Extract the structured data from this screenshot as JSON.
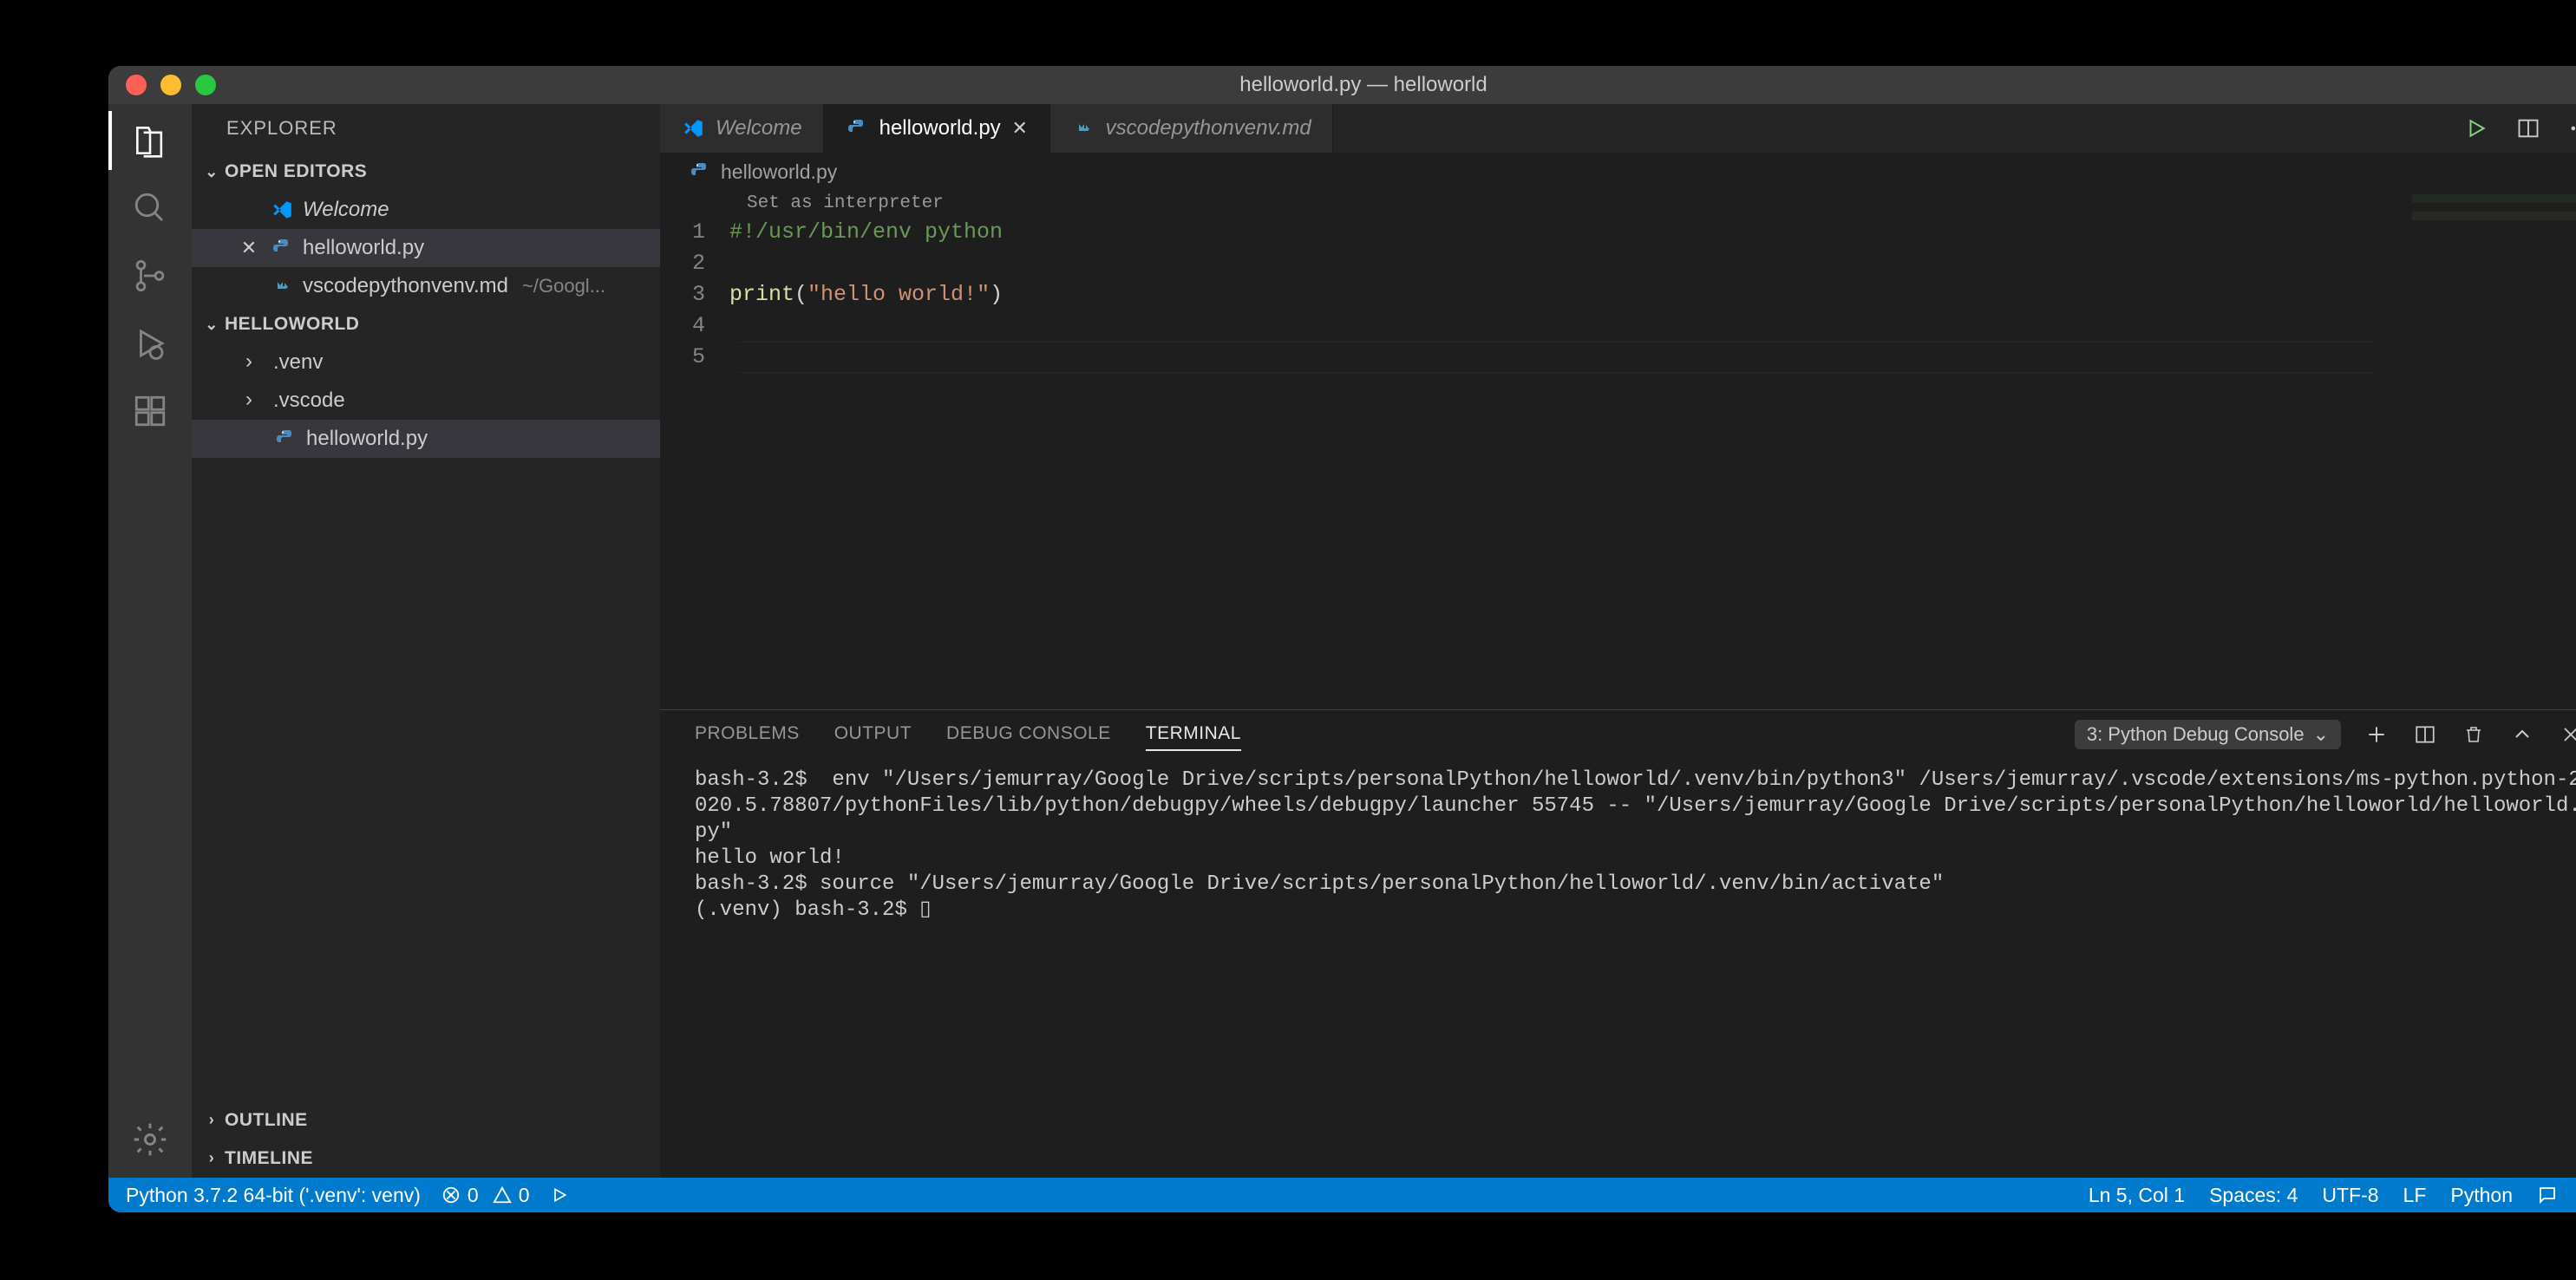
{
  "window": {
    "title": "helloworld.py — helloworld"
  },
  "sidebar": {
    "title": "EXPLORER",
    "openEditorsHeader": "OPEN EDITORS",
    "openEditors": [
      {
        "label": "Welcome",
        "icon": "vscode",
        "italic": true
      },
      {
        "label": "helloworld.py",
        "icon": "python",
        "active": true
      },
      {
        "label": "vscodepythonvenv.md",
        "icon": "markdown",
        "desc": "~/Googl..."
      }
    ],
    "folderHeader": "HELLOWORLD",
    "folderItems": [
      {
        "label": ".venv",
        "kind": "folder"
      },
      {
        "label": ".vscode",
        "kind": "folder"
      },
      {
        "label": "helloworld.py",
        "kind": "file",
        "icon": "python",
        "selected": true
      }
    ],
    "outlineHeader": "OUTLINE",
    "timelineHeader": "TIMELINE"
  },
  "tabs": [
    {
      "label": "Welcome",
      "icon": "vscode",
      "italic": true
    },
    {
      "label": "helloworld.py",
      "icon": "python",
      "active": true,
      "closable": true
    },
    {
      "label": "vscodepythonvenv.md",
      "icon": "markdown",
      "italic": true
    }
  ],
  "breadcrumb": {
    "file": "helloworld.py"
  },
  "codelens": "Set as interpreter",
  "code": {
    "lines": [
      {
        "n": "1",
        "html": "<span class='tok-comment'>#!/usr/bin/env python</span>"
      },
      {
        "n": "2",
        "html": ""
      },
      {
        "n": "3",
        "html": "<span class='tok-func'>print</span><span class='tok-punct'>(</span><span class='tok-string'>\"hello world!\"</span><span class='tok-punct'>)</span>"
      },
      {
        "n": "4",
        "html": ""
      },
      {
        "n": "5",
        "html": ""
      }
    ],
    "currentLine": 5
  },
  "panel": {
    "tabs": [
      "PROBLEMS",
      "OUTPUT",
      "DEBUG CONSOLE",
      "TERMINAL"
    ],
    "activeTab": "TERMINAL",
    "terminalSelector": "3: Python Debug Console",
    "terminalText": "bash-3.2$  env \"/Users/jemurray/Google Drive/scripts/personalPython/helloworld/.venv/bin/python3\" /Users/jemurray/.vscode/extensions/ms-python.python-2020.5.78807/pythonFiles/lib/python/debugpy/wheels/debugpy/launcher 55745 -- \"/Users/jemurray/Google Drive/scripts/personalPython/helloworld/helloworld.py\"\nhello world!\nbash-3.2$ source \"/Users/jemurray/Google Drive/scripts/personalPython/helloworld/.venv/bin/activate\"\n(.venv) bash-3.2$ ▯"
  },
  "status": {
    "python": "Python 3.7.2 64-bit ('.venv': venv)",
    "errors": "0",
    "warnings": "0",
    "lncol": "Ln 5, Col 1",
    "spaces": "Spaces: 4",
    "encoding": "UTF-8",
    "eol": "LF",
    "lang": "Python"
  }
}
